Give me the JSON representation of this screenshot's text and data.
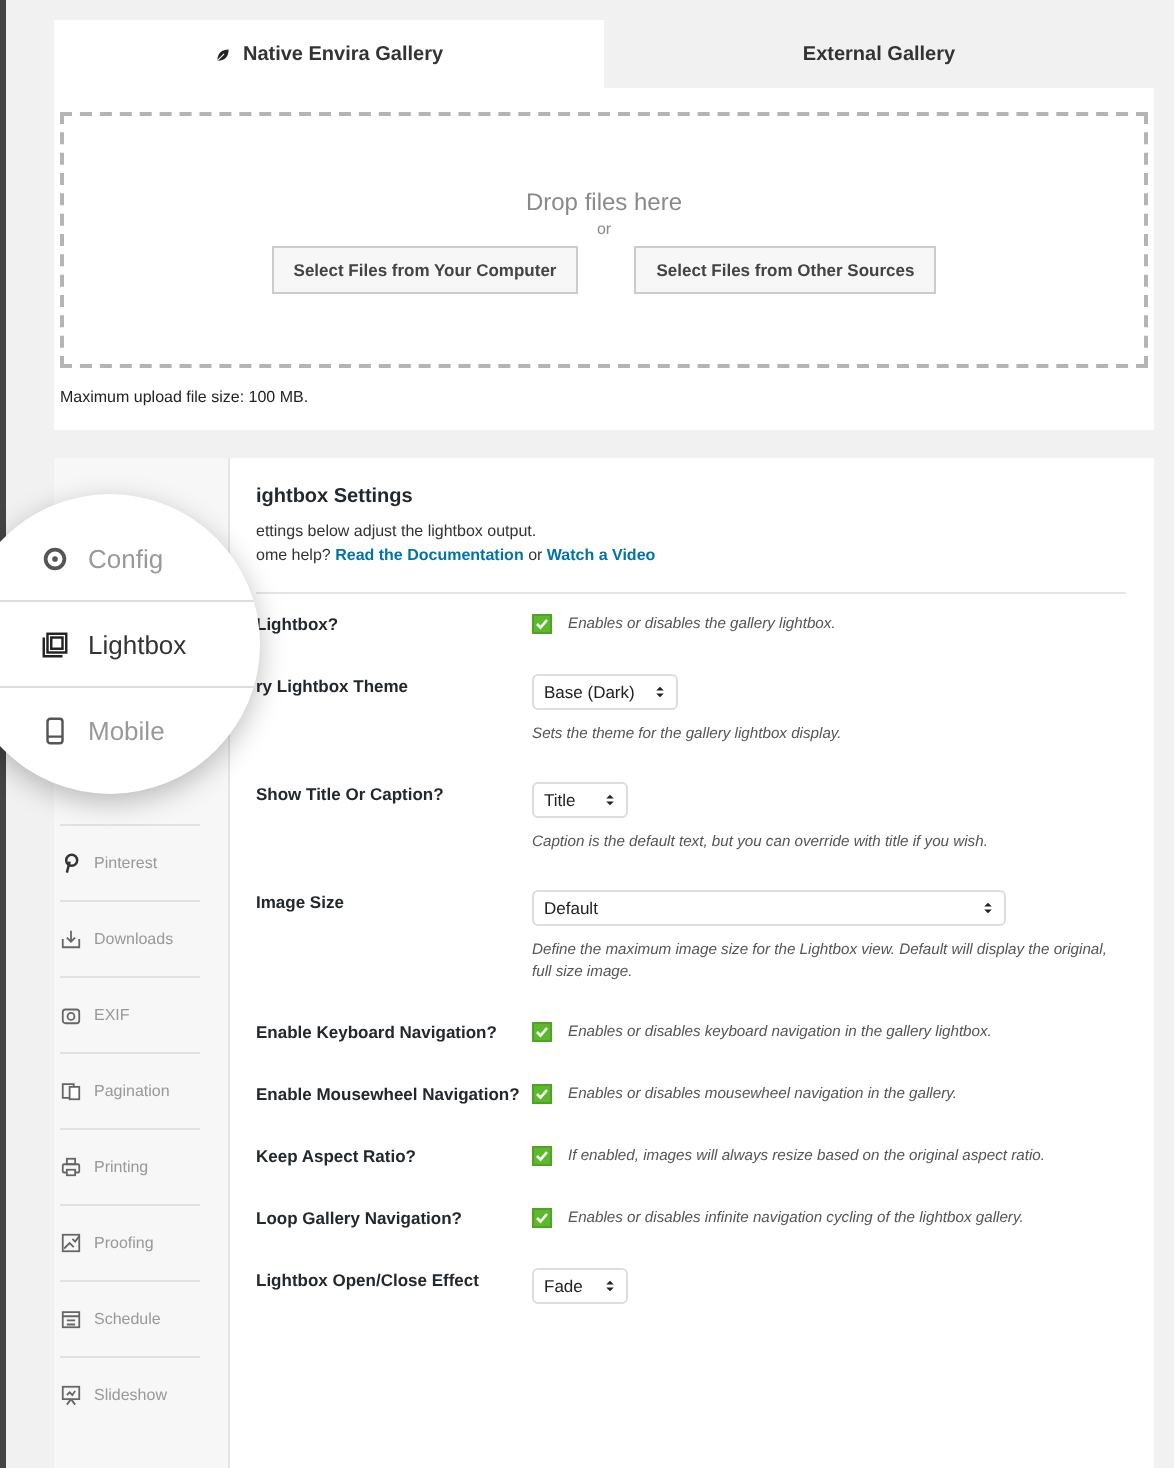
{
  "tabs": [
    {
      "label": "Native Envira Gallery",
      "kind": "native",
      "selected": true
    },
    {
      "label": "External Gallery",
      "kind": "external",
      "selected": false
    }
  ],
  "upload": {
    "drop_text": "Drop files here",
    "or_text": "or",
    "buttons": [
      "Select Files from Your Computer",
      "Select Files from Other Sources"
    ],
    "max_size": "Maximum upload file size: 100 MB."
  },
  "magnifier": {
    "items": [
      {
        "label": "Config",
        "selected": false
      },
      {
        "label": "Lightbox",
        "selected": true
      },
      {
        "label": "Mobile",
        "selected": false
      }
    ]
  },
  "sidebar": {
    "items": [
      {
        "label": "Pinterest"
      },
      {
        "label": "Downloads"
      },
      {
        "label": "EXIF"
      },
      {
        "label": "Pagination"
      },
      {
        "label": "Printing"
      },
      {
        "label": "Proofing"
      },
      {
        "label": "Schedule"
      },
      {
        "label": "Slideshow"
      }
    ]
  },
  "settings": {
    "title": "ightbox Settings",
    "intro": "ettings below adjust the lightbox output.",
    "help_prefix": "ome help?",
    "links": [
      "Read the Documentation",
      "Watch a Video"
    ],
    "link_joiner": "or",
    "rows": [
      {
        "label": "Lightbox?",
        "kind": "checkbox",
        "checked": true,
        "description": "Enables or disables the gallery lightbox."
      },
      {
        "label": "ry Lightbox Theme",
        "kind": "select",
        "value": "Base (Dark)",
        "description": "Sets the theme for the gallery lightbox display."
      },
      {
        "label": "Show Title Or Caption?",
        "kind": "select",
        "value": "Title",
        "description": "Caption is the default text, but you can override with title if you wish."
      },
      {
        "label": "Image Size",
        "kind": "wide-select",
        "value": "Default",
        "description": "Define the maximum image size for the Lightbox view. Default will display the original, full size image."
      },
      {
        "label": "Enable Keyboard Navigation?",
        "kind": "checkbox",
        "checked": true,
        "description": "Enables or disables keyboard navigation in the gallery lightbox."
      },
      {
        "label": "Enable Mousewheel Navigation?",
        "kind": "checkbox",
        "checked": true,
        "description": "Enables or disables mousewheel navigation in the gallery."
      },
      {
        "label": "Keep Aspect Ratio?",
        "kind": "checkbox",
        "checked": true,
        "description": "If enabled, images will always resize based on the original aspect ratio."
      },
      {
        "label": "Loop Gallery Navigation?",
        "kind": "checkbox",
        "checked": true,
        "description": "Enables or disables infinite navigation cycling of the lightbox gallery."
      },
      {
        "label": "Lightbox Open/Close Effect",
        "kind": "select",
        "value": "Fade"
      }
    ]
  }
}
